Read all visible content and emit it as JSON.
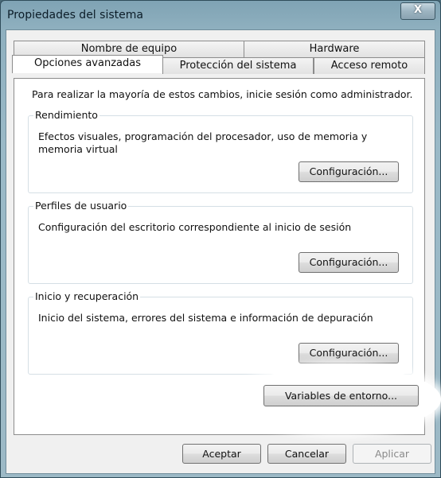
{
  "window": {
    "title": "Propiedades del sistema",
    "close_label": "X"
  },
  "tabs": {
    "row_back": [
      {
        "label": "Nombre de equipo"
      },
      {
        "label": "Hardware"
      }
    ],
    "row_front": [
      {
        "label": "Opciones avanzadas",
        "active": true
      },
      {
        "label": "Protección del sistema"
      },
      {
        "label": "Acceso remoto"
      }
    ]
  },
  "panel": {
    "intro": "Para realizar la mayoría de estos cambios, inicie sesión como administrador.",
    "groups": [
      {
        "title": "Rendimiento",
        "description": "Efectos visuales, programación del procesador, uso de memoria y memoria virtual",
        "button": "Configuración..."
      },
      {
        "title": "Perfiles de usuario",
        "description": "Configuración del escritorio correspondiente al inicio de sesión",
        "button": "Configuración..."
      },
      {
        "title": "Inicio y recuperación",
        "description": "Inicio del sistema, errores del sistema e información de depuración",
        "button": "Configuración..."
      }
    ],
    "env_button": "Variables de entorno..."
  },
  "footer": {
    "ok": "Aceptar",
    "cancel": "Cancelar",
    "apply": "Aplicar"
  }
}
